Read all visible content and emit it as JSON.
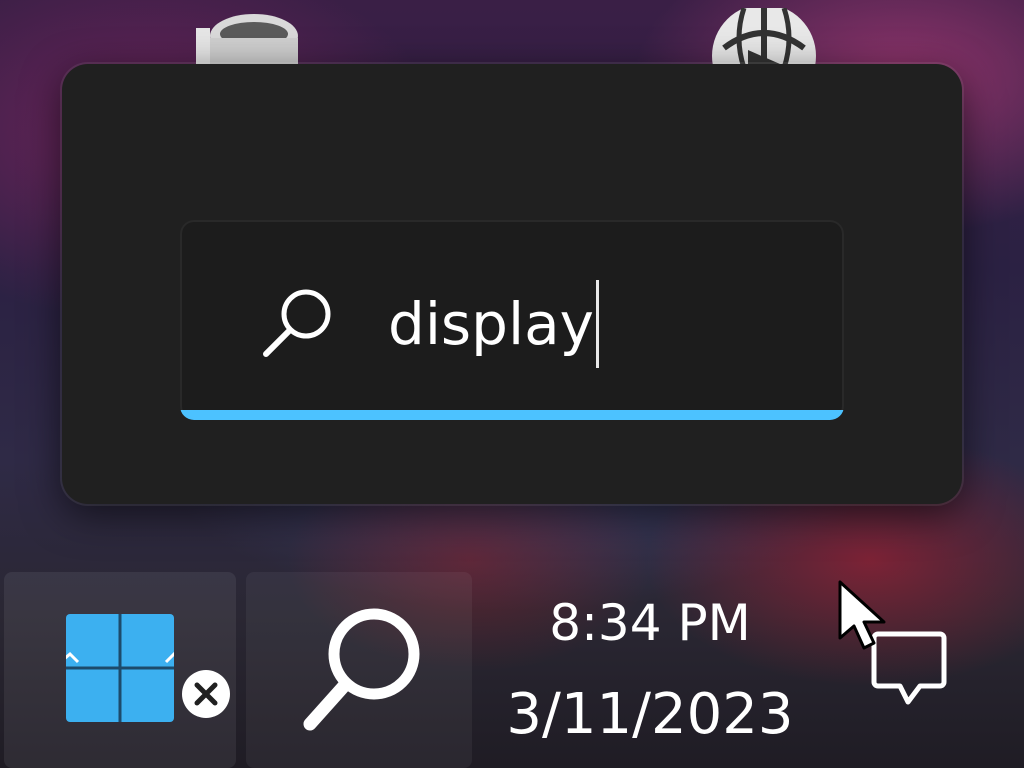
{
  "desktop": {
    "icons": [
      {
        "name": "recycle-bin"
      },
      {
        "name": "media-player"
      }
    ]
  },
  "search_flyout": {
    "query": "display",
    "icon": "search-icon",
    "accent_color": "#4cc2ff"
  },
  "taskbar": {
    "start_icon": "windows-logo-icon",
    "start_badge_icon": "close-badge-icon",
    "search_icon": "search-icon",
    "clock": {
      "time": "8:34 PM",
      "date": "3/11/2023"
    },
    "notification_icon": "notification-icon"
  }
}
